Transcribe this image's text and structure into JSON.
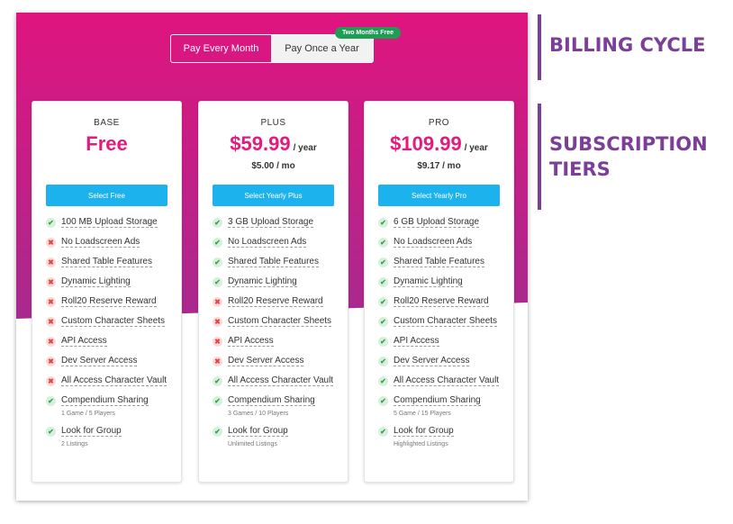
{
  "billing": {
    "option_monthly": "Pay Every Month",
    "option_yearly": "Pay Once a Year",
    "selected": "Pay Once a Year",
    "promo_badge": "Two Months Free"
  },
  "tiers": [
    {
      "name": "BASE",
      "price": "Free",
      "period": "",
      "monthly": "",
      "button": "Select Free",
      "features": [
        {
          "label": "100 MB Upload Storage",
          "included": true,
          "sub": ""
        },
        {
          "label": "No Loadscreen Ads",
          "included": false,
          "sub": ""
        },
        {
          "label": "Shared Table Features",
          "included": false,
          "sub": ""
        },
        {
          "label": "Dynamic Lighting",
          "included": false,
          "sub": ""
        },
        {
          "label": "Roll20 Reserve Reward",
          "included": false,
          "sub": ""
        },
        {
          "label": "Custom Character Sheets",
          "included": false,
          "sub": ""
        },
        {
          "label": "API Access",
          "included": false,
          "sub": ""
        },
        {
          "label": "Dev Server Access",
          "included": false,
          "sub": ""
        },
        {
          "label": "All Access Character Vault",
          "included": false,
          "sub": ""
        },
        {
          "label": "Compendium Sharing",
          "included": true,
          "sub": "1 Game / 5 Players"
        },
        {
          "label": "Look for Group",
          "included": true,
          "sub": "2 Listings"
        }
      ]
    },
    {
      "name": "PLUS",
      "price": "$59.99",
      "period": "/ year",
      "monthly": "$5.00  / mo",
      "button": "Select Yearly Plus",
      "features": [
        {
          "label": "3 GB Upload Storage",
          "included": true,
          "sub": ""
        },
        {
          "label": "No Loadscreen Ads",
          "included": true,
          "sub": ""
        },
        {
          "label": "Shared Table Features",
          "included": true,
          "sub": ""
        },
        {
          "label": "Dynamic Lighting",
          "included": true,
          "sub": ""
        },
        {
          "label": "Roll20 Reserve Reward",
          "included": false,
          "sub": ""
        },
        {
          "label": "Custom Character Sheets",
          "included": false,
          "sub": ""
        },
        {
          "label": "API Access",
          "included": false,
          "sub": ""
        },
        {
          "label": "Dev Server Access",
          "included": false,
          "sub": ""
        },
        {
          "label": "All Access Character Vault",
          "included": true,
          "sub": ""
        },
        {
          "label": "Compendium Sharing",
          "included": true,
          "sub": "3 Games / 10 Players"
        },
        {
          "label": "Look for Group",
          "included": true,
          "sub": "Unlimited Listings"
        }
      ]
    },
    {
      "name": "PRO",
      "price": "$109.99",
      "period": "/ year",
      "monthly": "$9.17  / mo",
      "button": "Select Yearly Pro",
      "features": [
        {
          "label": "6 GB Upload Storage",
          "included": true,
          "sub": ""
        },
        {
          "label": "No Loadscreen Ads",
          "included": true,
          "sub": ""
        },
        {
          "label": "Shared Table Features",
          "included": true,
          "sub": ""
        },
        {
          "label": "Dynamic Lighting",
          "included": true,
          "sub": ""
        },
        {
          "label": "Roll20 Reserve Reward",
          "included": true,
          "sub": ""
        },
        {
          "label": "Custom Character Sheets",
          "included": true,
          "sub": ""
        },
        {
          "label": "API Access",
          "included": true,
          "sub": ""
        },
        {
          "label": "Dev Server Access",
          "included": true,
          "sub": ""
        },
        {
          "label": "All Access Character Vault",
          "included": true,
          "sub": ""
        },
        {
          "label": "Compendium Sharing",
          "included": true,
          "sub": "5 Game / 15 Players"
        },
        {
          "label": "Look for Group",
          "included": true,
          "sub": "Highlighted Listings"
        }
      ]
    }
  ],
  "annotations": {
    "billing_cycle": "BILLING CYCLE",
    "subscription_tiers_line1": "SUBSCRIPTION",
    "subscription_tiers_line2": "TIERS"
  },
  "colors": {
    "brand_pink": "#e6197d",
    "hero_top": "#e0147f",
    "hero_bottom": "#a82a8e",
    "button_blue": "#1cb2ee",
    "badge_green": "#1f9d55",
    "annotation_purple": "#7b3f98",
    "check_green": "#3a9d4f",
    "cross_red": "#e04848"
  },
  "icons": {
    "included": "check-icon",
    "excluded": "cross-icon"
  }
}
